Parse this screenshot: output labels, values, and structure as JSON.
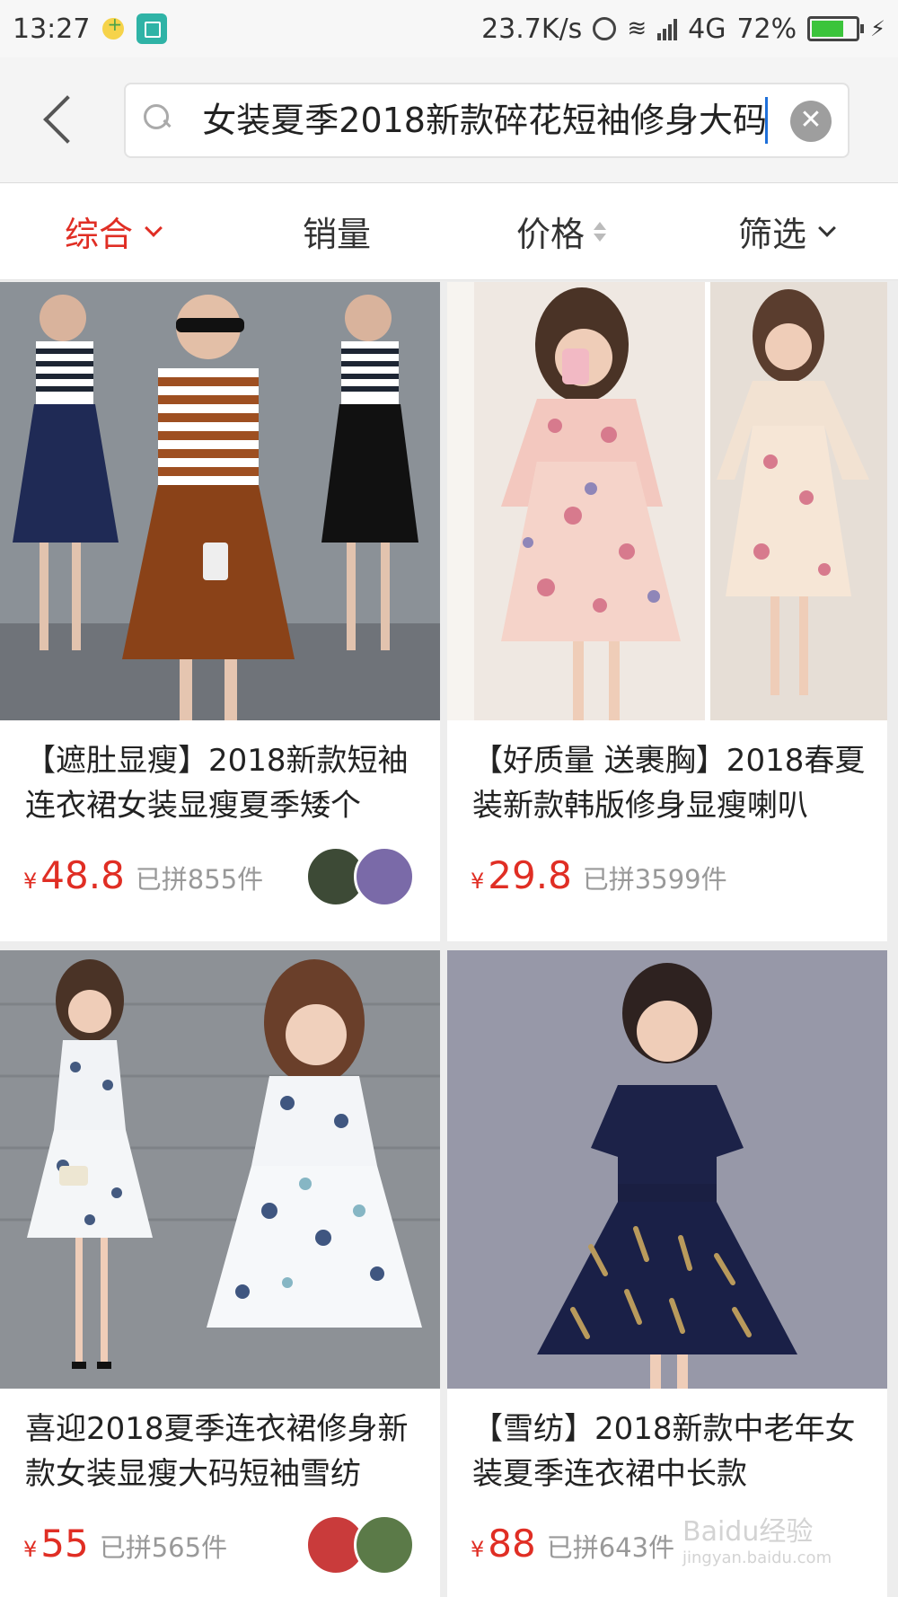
{
  "status_bar": {
    "time": "13:27",
    "speed": "23.7K/s",
    "network": "4G",
    "battery": "72%",
    "battery_level": 0.72,
    "icons": [
      "notification-dot-icon",
      "scan-icon",
      "alarm-icon",
      "wifi-icon",
      "signal-icon",
      "battery-icon",
      "charging-icon"
    ]
  },
  "search": {
    "query": "女装夏季2018新款碎花短袖修身大码",
    "visible_query": "夏季2018新款碎花短袖修身大码",
    "clear_symbol": "✕"
  },
  "sort_tabs": [
    {
      "label": "综合",
      "active": true,
      "icon": "chevron-down-icon"
    },
    {
      "label": "销量",
      "active": false
    },
    {
      "label": "价格",
      "active": false,
      "icon": "sort-updown-icon"
    },
    {
      "label": "筛选",
      "active": false,
      "icon": "chevron-down-icon"
    }
  ],
  "products": [
    {
      "title": "【遮肚显瘦】2018新款短袖连衣裙女装显瘦夏季矮个",
      "currency": "¥",
      "price": "48.8",
      "sold": "已拼855件",
      "has_avatars": true
    },
    {
      "title": "【好质量 送裹胸】2018春夏装新款韩版修身显瘦喇叭",
      "currency": "¥",
      "price": "29.8",
      "sold": "已拼3599件",
      "has_avatars": false
    },
    {
      "title": "喜迎2018夏季连衣裙修身新款女装显瘦大码短袖雪纺",
      "currency": "¥",
      "price": "55",
      "sold": "已拼565件",
      "has_avatars": true
    },
    {
      "title": "【雪纺】2018新款中老年女装夏季连衣裙中长款",
      "currency": "¥",
      "price": "88",
      "sold": "已拼643件",
      "has_avatars": false
    }
  ],
  "watermark": {
    "text": "Baidu经验",
    "sub": "jingyan.baidu.com"
  },
  "colors": {
    "accent": "#e02e24",
    "background": "#ededed",
    "muted": "#999999"
  }
}
